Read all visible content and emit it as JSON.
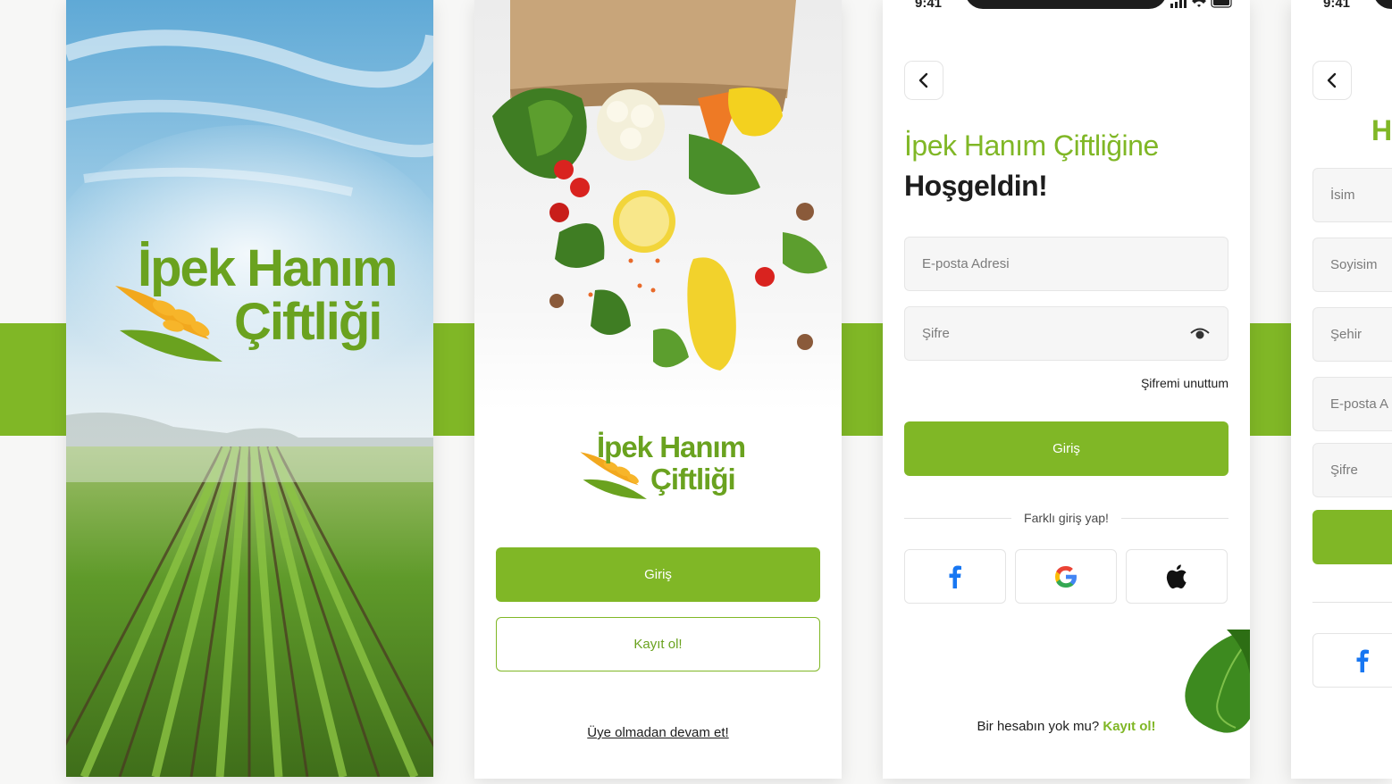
{
  "brand": {
    "name_line1": "İpek Hanım",
    "name_line2": "Çiftliği",
    "primary_color": "#80b726",
    "dark_text_color": "#1d1d1d"
  },
  "splash": {
    "background": "sky-and-farm-field-photo",
    "logo_icon": "wheat-icon"
  },
  "welcome": {
    "hero_image": "grocery-bag-vegetables-photo",
    "login_button": "Giriş",
    "register_button": "Kayıt ol!",
    "guest_link": "Üye olmadan devam et!"
  },
  "login": {
    "status_time": "9:41",
    "status_icons": [
      "signal-icon",
      "wifi-icon",
      "battery-icon"
    ],
    "back_icon": "chevron-left-icon",
    "title_line1": "İpek Hanım Çiftliğine",
    "title_line2": "Hoşgeldin!",
    "email_placeholder": "E-posta Adresi",
    "password_placeholder": "Şifre",
    "password_toggle_icon": "eye-icon",
    "forgot_password": "Şifremi unuttum",
    "submit_button": "Giriş",
    "alt_login_label": "Farklı giriş yap!",
    "social_buttons": [
      "facebook-icon",
      "google-icon",
      "apple-icon"
    ],
    "no_account_text": "Bir hesabın yok mu?",
    "signup_link": "Kayıt ol!"
  },
  "register": {
    "status_time": "9:41",
    "title_partial": "H",
    "fields": [
      "İsim",
      "Soyisim",
      "Şehir",
      "E-posta A",
      "Şifre"
    ],
    "social_icon": "facebook-icon"
  }
}
